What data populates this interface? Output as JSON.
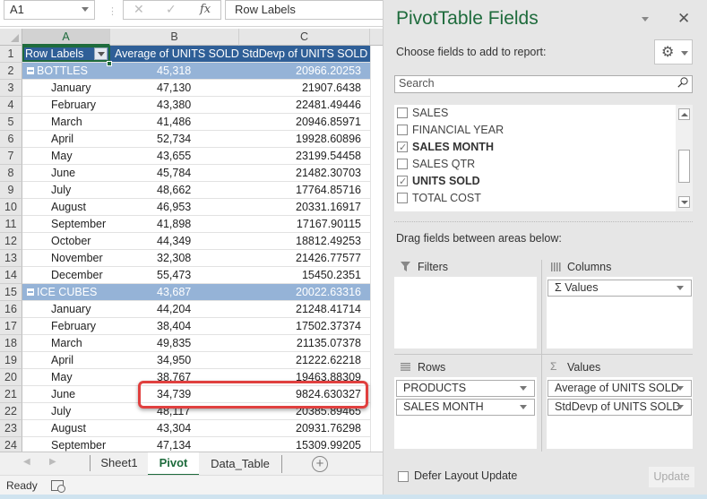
{
  "formula_bar": {
    "name_box": "A1",
    "cancel_icon": "✕",
    "enter_icon": "✓",
    "fx_label": "fx",
    "formula_value": "Row Labels"
  },
  "columns": [
    "A",
    "B",
    "C",
    ""
  ],
  "pivot": {
    "header": {
      "row_number": "1",
      "row_labels": "Row Labels",
      "col_b": "Average of UNITS SOLD",
      "col_c": "StdDevp of UNITS SOLD"
    },
    "rows": [
      {
        "n": "2",
        "type": "group",
        "label": "BOTTLES",
        "avg": "45,318",
        "std": "20966.20253"
      },
      {
        "n": "3",
        "type": "item",
        "label": "January",
        "avg": "47,130",
        "std": "21907.6438"
      },
      {
        "n": "4",
        "type": "item",
        "label": "February",
        "avg": "43,380",
        "std": "22481.49446"
      },
      {
        "n": "5",
        "type": "item",
        "label": "March",
        "avg": "41,486",
        "std": "20946.85971"
      },
      {
        "n": "6",
        "type": "item",
        "label": "April",
        "avg": "52,734",
        "std": "19928.60896"
      },
      {
        "n": "7",
        "type": "item",
        "label": "May",
        "avg": "43,655",
        "std": "23199.54458"
      },
      {
        "n": "8",
        "type": "item",
        "label": "June",
        "avg": "45,784",
        "std": "21482.30703"
      },
      {
        "n": "9",
        "type": "item",
        "label": "July",
        "avg": "48,662",
        "std": "17764.85716"
      },
      {
        "n": "10",
        "type": "item",
        "label": "August",
        "avg": "46,953",
        "std": "20331.16917"
      },
      {
        "n": "11",
        "type": "item",
        "label": "September",
        "avg": "41,898",
        "std": "17167.90115"
      },
      {
        "n": "12",
        "type": "item",
        "label": "October",
        "avg": "44,349",
        "std": "18812.49253"
      },
      {
        "n": "13",
        "type": "item",
        "label": "November",
        "avg": "32,308",
        "std": "21426.77577"
      },
      {
        "n": "14",
        "type": "item",
        "label": "December",
        "avg": "55,473",
        "std": "15450.2351"
      },
      {
        "n": "15",
        "type": "group",
        "label": "ICE CUBES",
        "avg": "43,687",
        "std": "20022.63316"
      },
      {
        "n": "16",
        "type": "item",
        "label": "January",
        "avg": "44,204",
        "std": "21248.41714"
      },
      {
        "n": "17",
        "type": "item",
        "label": "February",
        "avg": "38,404",
        "std": "17502.37374"
      },
      {
        "n": "18",
        "type": "item",
        "label": "March",
        "avg": "49,835",
        "std": "21135.07378"
      },
      {
        "n": "19",
        "type": "item",
        "label": "April",
        "avg": "34,950",
        "std": "21222.62218"
      },
      {
        "n": "20",
        "type": "item",
        "label": "May",
        "avg": "38,767",
        "std": "19463.88309"
      },
      {
        "n": "21",
        "type": "item",
        "label": "June",
        "avg": "34,739",
        "std": "9824.630327",
        "highlighted": true
      },
      {
        "n": "22",
        "type": "item",
        "label": "July",
        "avg": "48,117",
        "std": "20385.89465"
      },
      {
        "n": "23",
        "type": "item",
        "label": "August",
        "avg": "43,304",
        "std": "20931.76298"
      },
      {
        "n": "24",
        "type": "item",
        "label": "September",
        "avg": "47,134",
        "std": "15309.99205"
      }
    ]
  },
  "sheet_tabs": {
    "prev_icon": "◀",
    "next_icon": "▶",
    "tabs": [
      "Sheet1",
      "Pivot",
      "Data_Table"
    ],
    "active": "Pivot",
    "add_icon": "+"
  },
  "status_bar": {
    "text": "Ready"
  },
  "pivot_pane": {
    "title": "PivotTable Fields",
    "close_icon": "✕",
    "choose_label": "Choose fields to add to report:",
    "gear_icon": "⚙",
    "search_placeholder": "Search",
    "fields": [
      {
        "name": "SALES",
        "checked": false
      },
      {
        "name": "FINANCIAL YEAR",
        "checked": false
      },
      {
        "name": "SALES MONTH",
        "checked": true
      },
      {
        "name": "SALES QTR",
        "checked": false
      },
      {
        "name": "UNITS SOLD",
        "checked": true
      },
      {
        "name": "TOTAL COST",
        "checked": false
      }
    ],
    "drag_label": "Drag fields between areas below:",
    "areas": {
      "filters": {
        "title": "Filters",
        "items": []
      },
      "columns": {
        "title": "Columns",
        "items": [
          "Values"
        ]
      },
      "rows": {
        "title": "Rows",
        "items": [
          "PRODUCTS",
          "SALES MONTH"
        ]
      },
      "values": {
        "title": "Values",
        "items": [
          "Average of UNITS SOLD",
          "StdDevp of UNITS SOLD"
        ]
      }
    },
    "sigma": "Σ",
    "defer_label": "Defer Layout Update",
    "defer_checked": false,
    "update_label": "Update"
  },
  "colors": {
    "excel_green": "#1e6b3c",
    "pivot_header": "#2f5f97",
    "pivot_group": "#95b3d7",
    "highlight_box": "#e0403f"
  }
}
